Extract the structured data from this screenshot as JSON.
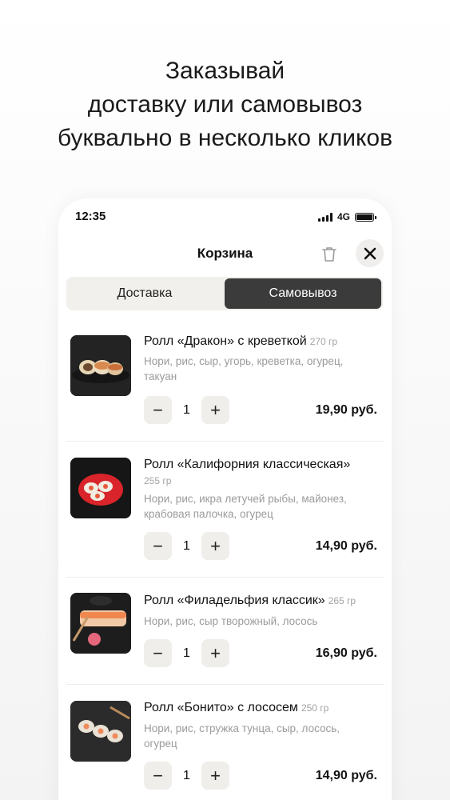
{
  "headline": {
    "line1": "Заказывай",
    "line2": "доставку или самовывоз",
    "line3": "буквально в несколько кликов"
  },
  "status_bar": {
    "time": "12:35",
    "network": "4G"
  },
  "cart": {
    "title": "Корзина",
    "tabs": [
      {
        "label": "Доставка",
        "active": false
      },
      {
        "label": "Самовывоз",
        "active": true
      }
    ],
    "items": [
      {
        "name": "Ролл «Дракон» с креветкой",
        "weight": "270 гр",
        "description": "Нори, рис, сыр, угорь, креветка, огурец, такуан",
        "quantity": "1",
        "price": "19,90 руб."
      },
      {
        "name": "Ролл «Калифорния классическая»",
        "weight": "255 гр",
        "description": "Нори, рис, икра летучей рыбы, майонез, крабовая палочка, огурец",
        "quantity": "1",
        "price": "14,90 руб."
      },
      {
        "name": "Ролл «Филадельфия классик»",
        "weight": "265 гр",
        "description": "Нори, рис, сыр творожный, лосось",
        "quantity": "1",
        "price": "16,90 руб."
      },
      {
        "name": "Ролл «Бонито» с лососем",
        "weight": "250 гр",
        "description": "Нори, рис, стружка тунца, сыр, лосось, огурец",
        "quantity": "1",
        "price": "14,90 руб."
      }
    ],
    "minus_symbol": "−",
    "plus_symbol": "+"
  },
  "icons": {
    "trash": "trash-icon",
    "close": "close-icon",
    "signal": "signal-icon",
    "battery": "battery-icon"
  },
  "colors": {
    "active_tab": "#3b3b3b",
    "segment_bg": "#f2f0ec",
    "stepper_bg": "#f0eeea",
    "muted_text": "#9b9b9b"
  }
}
